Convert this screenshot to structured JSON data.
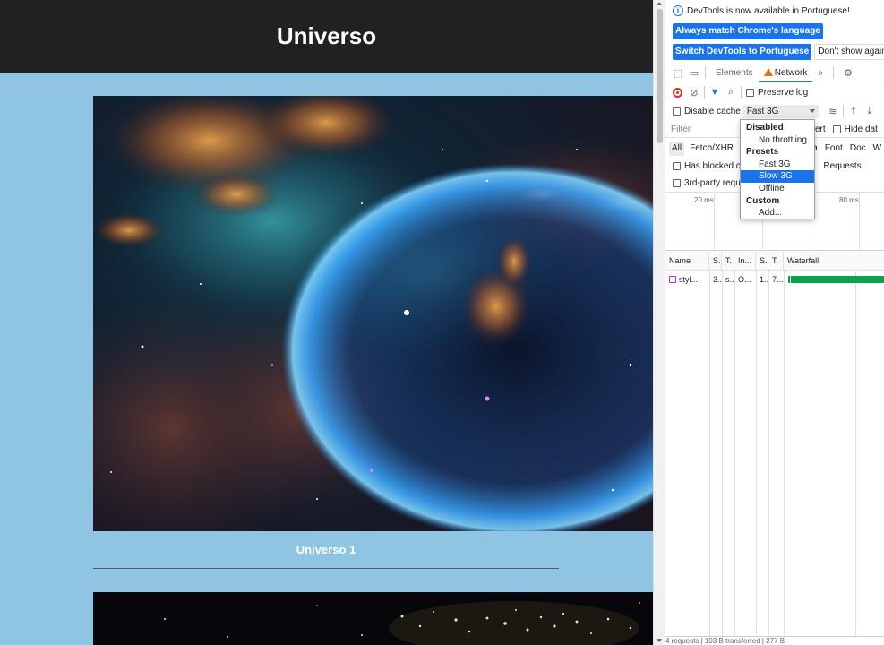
{
  "page": {
    "title": "Universo",
    "caption_1": "Universo 1",
    "colors": {
      "header_bg": "#212121",
      "page_bg": "#8fc4e3"
    }
  },
  "devtools": {
    "banner_text": "DevTools is now available in Portuguese!",
    "btn_always_match": "Always match Chrome's language",
    "btn_switch": "Switch DevTools to Portuguese",
    "btn_dont_show": "Don't show again",
    "tabs": {
      "elements": "Elements",
      "network": "Network",
      "more": "»"
    },
    "preserve_log": "Preserve log",
    "disable_cache": "Disable cache",
    "throttle_value": "Fast 3G",
    "filter_placeholder": "Filter",
    "invert": "vert",
    "hide_data": "Hide dat",
    "types": {
      "all": "All",
      "fetch": "Fetch/XHR",
      "media": "ia",
      "font": "Font",
      "doc": "Doc",
      "ws": "W"
    },
    "has_blocked": "Has blocked co",
    "requests": "Requests",
    "third_party": "3rd-party requ",
    "timeline": {
      "t1": "20 ms",
      "t2": "80 ms"
    },
    "table": {
      "headers": {
        "name": "Name",
        "status": "S.",
        "type": "T.",
        "initiator": "In...",
        "size": "S.",
        "time": "T.",
        "waterfall": "Waterfall"
      },
      "rows": [
        {
          "name": "styl...",
          "status": "3..",
          "type": "s...",
          "initiator": "O...",
          "size": "1..",
          "time": "7..."
        }
      ]
    },
    "status_bar": "4 requests | 103 B transferred | 277 B"
  },
  "throttle_menu": {
    "items": [
      {
        "label": "Disabled",
        "kind": "header"
      },
      {
        "label": "No throttling",
        "kind": "item"
      },
      {
        "label": "Presets",
        "kind": "header"
      },
      {
        "label": "Fast 3G",
        "kind": "item"
      },
      {
        "label": "Slow 3G",
        "kind": "item",
        "selected": true
      },
      {
        "label": "Offline",
        "kind": "item"
      },
      {
        "label": "Custom",
        "kind": "header"
      },
      {
        "label": "Add...",
        "kind": "item"
      }
    ]
  }
}
